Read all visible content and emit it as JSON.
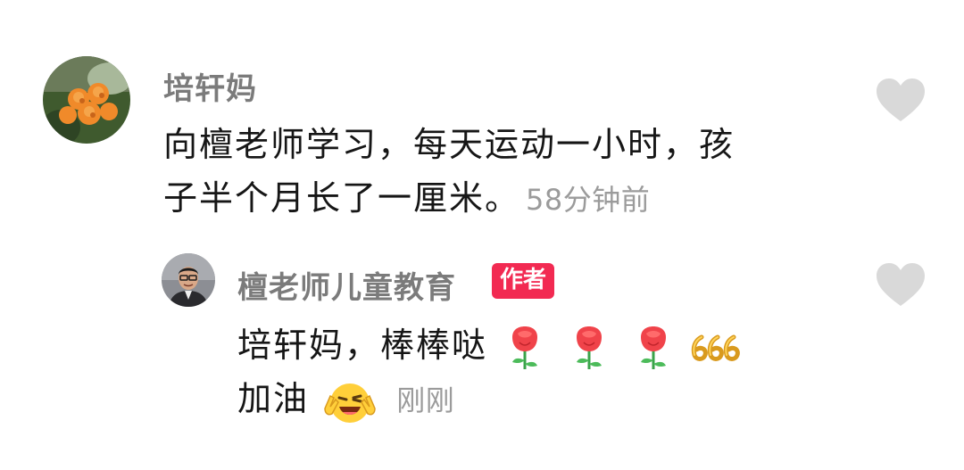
{
  "comment": {
    "username": "培轩妈",
    "text_line1": "向檀老师学习，每天运动一小时，孩",
    "text_line2": "子半个月长了一厘米。",
    "timestamp": "58分钟前",
    "avatar": "orange-rose-flowers",
    "liked": false
  },
  "reply": {
    "username": "檀老师儿童教育",
    "badge": "作者",
    "text_line1": "培轩妈，棒棒哒",
    "text_line2": "加油",
    "emojis_line1": [
      "rose-icon",
      "rose-icon",
      "rose-icon",
      "666-icon"
    ],
    "emojis_line2": [
      "wink-victory-icon"
    ],
    "timestamp": "刚刚",
    "avatar": "man-with-glasses",
    "liked": false
  },
  "colors": {
    "username": "#7b7b7b",
    "text": "#161616",
    "timestamp": "#9b9b9b",
    "badge_bg": "#f22a52",
    "heart": "#d9d9d9"
  }
}
